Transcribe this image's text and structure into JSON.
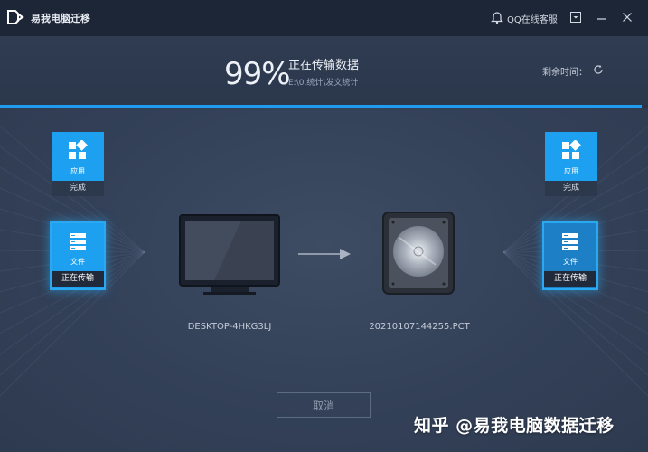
{
  "app": {
    "title": "易我电脑迁移",
    "support_label": "QQ在线客服"
  },
  "progress": {
    "percent_text": "99%",
    "fraction": 0.99,
    "status_title": "正在传输数据",
    "current_path": "E:\\0.统计\\发文统计",
    "remaining_label": "剩余时间："
  },
  "source": {
    "device_name": "DESKTOP-4HKG3LJ",
    "tiles": [
      {
        "label": "应用",
        "status": "完成"
      },
      {
        "label": "文件",
        "status": "正在传输"
      }
    ]
  },
  "target": {
    "device_name": "20210107144255.PCT",
    "tiles": [
      {
        "label": "应用",
        "status": "完成"
      },
      {
        "label": "文件",
        "status": "正在传输"
      }
    ]
  },
  "cancel_label": "取消",
  "watermark": "知乎 @易我电脑数据迁移",
  "colors": {
    "accent": "#1ea0f0",
    "titlebar": "#1d2636",
    "background": "#324057"
  },
  "icons": [
    "app-logo-icon",
    "qq-bell-icon",
    "dropdown-icon",
    "minimize-icon",
    "close-icon",
    "refresh-icon",
    "apps-icon",
    "files-icon",
    "monitor-icon",
    "disk-icon",
    "arrow-right-icon"
  ]
}
